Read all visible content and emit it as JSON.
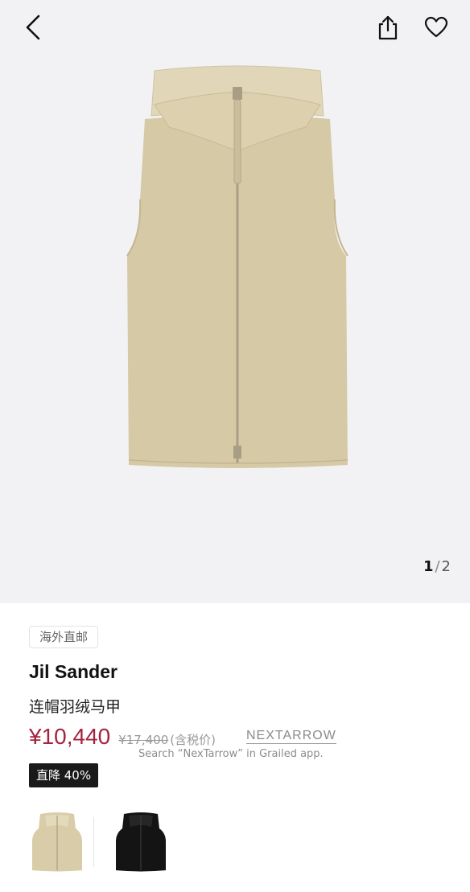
{
  "gallery": {
    "current": "1",
    "separator": "/",
    "total": "2",
    "product_color": "#d6c9a5"
  },
  "icons": {
    "back": "chevron-left-icon",
    "share": "share-icon",
    "favorite": "heart-icon"
  },
  "product": {
    "tag": "海外直邮",
    "brand": "Jil Sander",
    "name": "连帽羽绒马甲",
    "price": "¥10,440",
    "original_price": "¥17,400",
    "tax_note": "(含税价)",
    "discount": "直降 40%",
    "price_color": "#a5233f"
  },
  "watermark": {
    "logo": "NEXTARROW",
    "text": "Search “NexTarrow” in Grailed app."
  },
  "swatches": [
    {
      "color": "beige"
    },
    {
      "color": "black"
    }
  ]
}
